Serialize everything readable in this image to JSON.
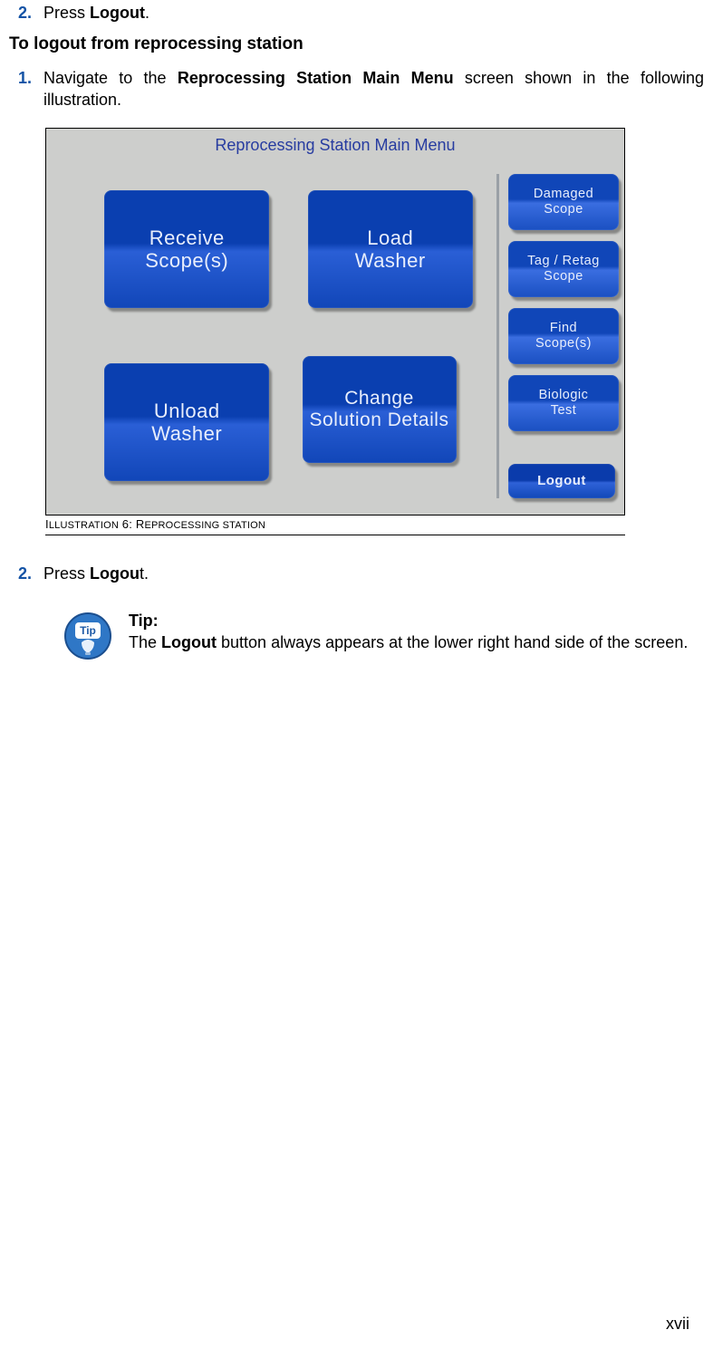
{
  "step_top": {
    "num": "2.",
    "pre": "Press ",
    "bold": "Logout",
    "post": "."
  },
  "heading": "To logout from reprocessing station",
  "step1": {
    "num": "1.",
    "pre": "Navigate to the ",
    "bold": "Reprocessing Station Main Menu",
    "post": " screen shown in the following illustration."
  },
  "illustration": {
    "title": "Reprocessing Station Main Menu",
    "main_buttons": {
      "receive": "Receive\nScope(s)",
      "load": "Load\nWasher",
      "unload": "Unload\nWasher",
      "change": "Change\nSolution Details"
    },
    "side_buttons": {
      "damaged": "Damaged\nScope",
      "tag": "Tag / Retag\nScope",
      "find": "Find\nScope(s)",
      "biologic": "Biologic\nTest",
      "logout": "Logout"
    },
    "caption_prefix": "I",
    "caption_word1": "LLUSTRATION",
    "caption_num": " 6: R",
    "caption_word2": "EPROCESSING STATION"
  },
  "step2": {
    "num": "2.",
    "pre": "Press ",
    "bold": "Logou",
    "post": "t."
  },
  "tip": {
    "title": "Tip:",
    "pre": "The ",
    "bold": "Logout",
    "post": " button always appears at the lower right hand side of the screen."
  },
  "page_number": "xvii"
}
